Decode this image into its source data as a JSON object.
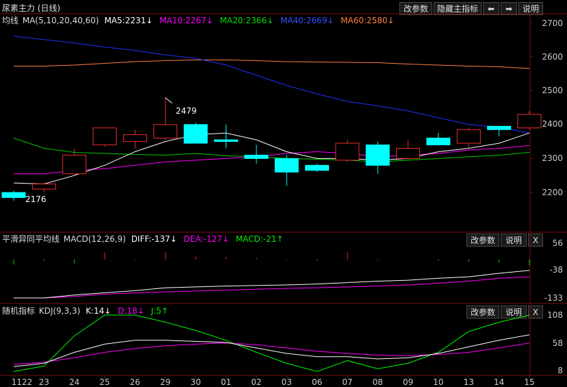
{
  "colors": {
    "up": "#e8302a",
    "down": "#00ffff",
    "ma5": "#ffffff",
    "ma10": "#ff00ff",
    "ma20": "#00cc00",
    "ma40": "#2030ff",
    "ma60": "#ff8040",
    "diff": "#ffffff",
    "dea": "#ff00ff",
    "k": "#ffffff",
    "d": "#ff00ff",
    "j": "#00ff00",
    "grid": "#7a0f0f"
  },
  "main": {
    "title": "尿素主力 (日线)",
    "buttons": {
      "params": "改参数",
      "hide": "隐藏主指标",
      "left": "⬅",
      "right": "➡",
      "help": "说明"
    },
    "legend": {
      "name": "均线",
      "ma_def": "MA(5,10,20,40,60)",
      "ma5": "MA5:2231↓",
      "ma10": "MA10:2267↓",
      "ma20": "MA20:2366↓",
      "ma40": "MA40:2669↓",
      "ma60": "MA60:2580↓"
    },
    "y_ticks": [
      "2700",
      "2600",
      "2500",
      "2400",
      "2300",
      "2200"
    ],
    "max_label": "2479",
    "min_label": "2176"
  },
  "macd": {
    "title": "平滑异同平均线",
    "legend": {
      "def": "MACD(12,26,9)",
      "diff": "DIFF:-137↓",
      "dea": "DEA:-127↓",
      "macd": "MACD:-21↑"
    },
    "buttons": {
      "params": "改参数",
      "help": "说明",
      "close": "X"
    },
    "y_ticks": [
      "56",
      "-38",
      "-133"
    ]
  },
  "kdj": {
    "title": "随机指标",
    "legend": {
      "def": "KDJ(9,3,3)",
      "k": "K:14↓",
      "d": "D:18↓",
      "j": "J:5↑"
    },
    "buttons": {
      "params": "改参数",
      "help": "说明",
      "close": "X"
    },
    "y_ticks": [
      "108",
      "58",
      "8"
    ]
  },
  "dates": [
    "1122",
    "23",
    "24",
    "25",
    "26",
    "29",
    "30",
    "01",
    "02",
    "03",
    "06",
    "07",
    "08",
    "09",
    "10",
    "13",
    "14",
    "15"
  ],
  "chart_data": {
    "type": "candlestick",
    "categories": [
      "1122",
      "23",
      "24",
      "25",
      "26",
      "29",
      "30",
      "01",
      "02",
      "03",
      "06",
      "07",
      "08",
      "09",
      "10",
      "13",
      "14",
      "15"
    ],
    "ohlc": [
      [
        2200,
        2205,
        2176,
        2185
      ],
      [
        2210,
        2230,
        2200,
        2225
      ],
      [
        2255,
        2330,
        2250,
        2310
      ],
      [
        2340,
        2390,
        2335,
        2390
      ],
      [
        2350,
        2385,
        2330,
        2370
      ],
      [
        2360,
        2479,
        2355,
        2400
      ],
      [
        2400,
        2405,
        2350,
        2345
      ],
      [
        2355,
        2400,
        2330,
        2350
      ],
      [
        2310,
        2340,
        2285,
        2300
      ],
      [
        2300,
        2310,
        2220,
        2260
      ],
      [
        2280,
        2285,
        2260,
        2265
      ],
      [
        2295,
        2355,
        2290,
        2345
      ],
      [
        2340,
        2350,
        2255,
        2280
      ],
      [
        2300,
        2355,
        2295,
        2330
      ],
      [
        2360,
        2375,
        2340,
        2340
      ],
      [
        2345,
        2390,
        2330,
        2385
      ],
      [
        2395,
        2395,
        2365,
        2385
      ],
      [
        2390,
        2440,
        2385,
        2430
      ]
    ],
    "ma5": [
      2228,
      2225,
      2250,
      2280,
      2320,
      2350,
      2370,
      2375,
      2355,
      2320,
      2300,
      2300,
      2295,
      2300,
      2320,
      2330,
      2345,
      2375
    ],
    "ma10": [
      2255,
      2255,
      2265,
      2270,
      2280,
      2290,
      2295,
      2300,
      2305,
      2315,
      2320,
      2315,
      2305,
      2310,
      2315,
      2325,
      2330,
      2338
    ],
    "ma20": [
      2360,
      2330,
      2318,
      2315,
      2312,
      2310,
      2315,
      2308,
      2305,
      2300,
      2298,
      2295,
      2290,
      2295,
      2300,
      2305,
      2310,
      2318
    ],
    "ma40": [
      2660,
      2650,
      2640,
      2628,
      2618,
      2605,
      2595,
      2575,
      2545,
      2515,
      2490,
      2468,
      2455,
      2440,
      2420,
      2400,
      2392,
      2375
    ],
    "ma60": [
      2572,
      2572,
      2575,
      2580,
      2585,
      2588,
      2590,
      2590,
      2588,
      2585,
      2584,
      2583,
      2582,
      2578,
      2575,
      2572,
      2570,
      2565
    ],
    "macd_hist": [
      -18,
      -5,
      -15,
      0,
      -2,
      0,
      10,
      8,
      5,
      -2,
      -5,
      0,
      -3,
      -2,
      -5,
      -8,
      -12,
      -21
    ],
    "diff": [
      -133,
      -133,
      -123,
      -115,
      -108,
      -98,
      -95,
      -92,
      -90,
      -88,
      -85,
      -80,
      -75,
      -72,
      -65,
      -60,
      -48,
      -38
    ],
    "dea": [
      -133,
      -133,
      -128,
      -120,
      -116,
      -112,
      -109,
      -106,
      -103,
      -100,
      -98,
      -95,
      -92,
      -88,
      -82,
      -75,
      -65,
      -60
    ],
    "k": [
      14,
      20,
      40,
      55,
      62,
      62,
      60,
      58,
      48,
      38,
      32,
      32,
      28,
      30,
      38,
      50,
      62,
      72
    ],
    "d": [
      18,
      22,
      30,
      40,
      47,
      52,
      55,
      57,
      54,
      48,
      42,
      38,
      35,
      34,
      36,
      40,
      48,
      57
    ],
    "j": [
      5,
      15,
      70,
      108,
      108,
      95,
      80,
      62,
      40,
      20,
      5,
      25,
      10,
      20,
      40,
      78,
      95,
      108
    ]
  }
}
